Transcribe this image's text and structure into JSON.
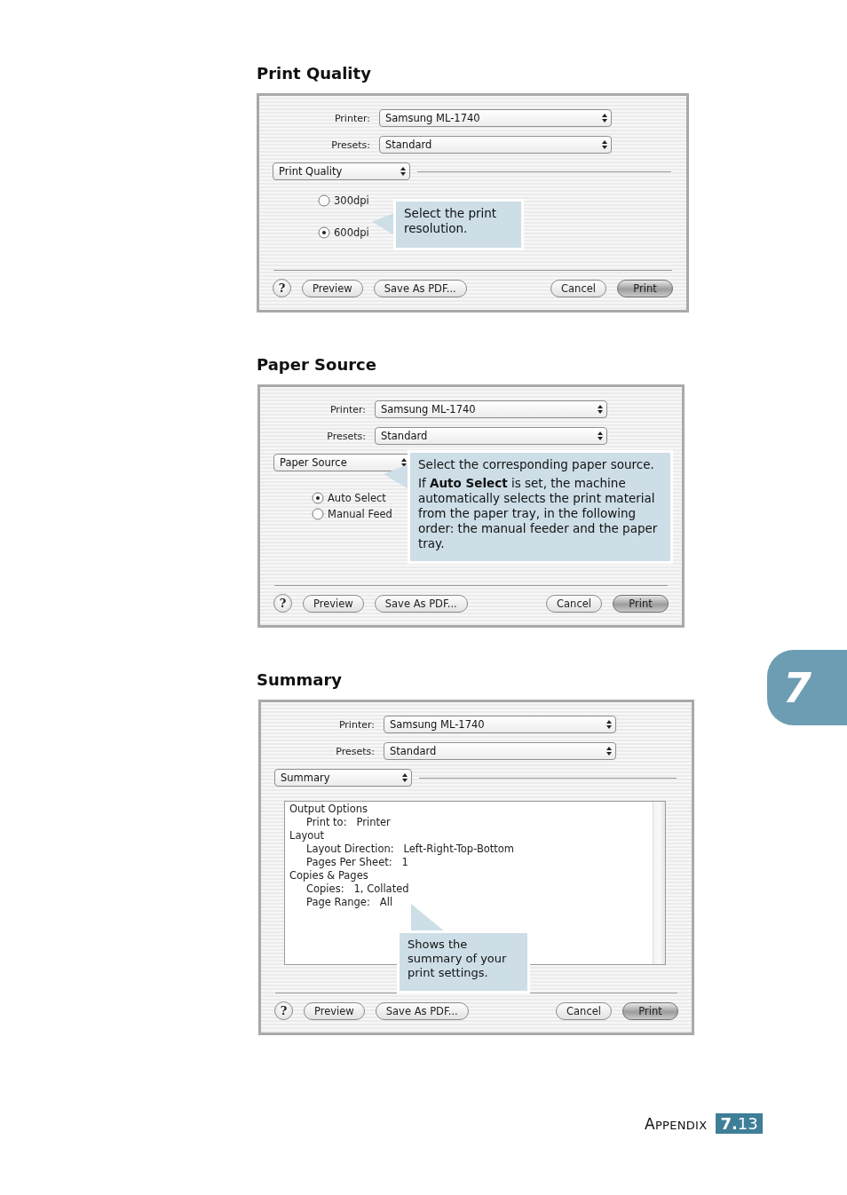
{
  "sections": [
    {
      "heading": "Print Quality",
      "dialog": {
        "fields": [
          {
            "label": "Printer:",
            "value": "Samsung ML-1740"
          },
          {
            "label": "Presets:",
            "value": "Standard"
          }
        ],
        "panel": "Print Quality",
        "content": {
          "kind": "radios",
          "options": [
            {
              "label": "300dpi",
              "selected": false
            },
            {
              "label": "600dpi",
              "selected": true
            }
          ]
        },
        "callout": [
          "Select the print resolution."
        ],
        "buttons": [
          {
            "label": "?",
            "kind": "help"
          },
          {
            "label": "Preview",
            "kind": "push"
          },
          {
            "label": "Save As PDF...",
            "kind": "push"
          },
          {
            "label": "Cancel",
            "kind": "push"
          },
          {
            "label": "Print",
            "kind": "default"
          }
        ]
      }
    },
    {
      "heading": "Paper Source",
      "dialog": {
        "fields": [
          {
            "label": "Printer:",
            "value": "Samsung ML-1740"
          },
          {
            "label": "Presets:",
            "value": "Standard"
          }
        ],
        "panel": "Paper Source",
        "content": {
          "kind": "radios",
          "options": [
            {
              "label": "Auto Select",
              "selected": true
            },
            {
              "label": "Manual Feed",
              "selected": false
            }
          ]
        },
        "callout": [
          "Select the corresponding paper source.",
          "If **Auto Select** is set, the machine automatically selects the print material from the paper tray, in the following order: the manual feeder and the paper tray."
        ],
        "buttons": [
          {
            "label": "?",
            "kind": "help"
          },
          {
            "label": "Preview",
            "kind": "push"
          },
          {
            "label": "Save As PDF...",
            "kind": "push"
          },
          {
            "label": "Cancel",
            "kind": "push"
          },
          {
            "label": "Print",
            "kind": "default"
          }
        ]
      }
    },
    {
      "heading": "Summary",
      "dialog": {
        "fields": [
          {
            "label": "Printer:",
            "value": "Samsung ML-1740"
          },
          {
            "label": "Presets:",
            "value": "Standard"
          }
        ],
        "panel": "Summary",
        "content": {
          "kind": "summary",
          "items": [
            {
              "label": "Output Options",
              "children": [
                {
                  "label": "Print to:",
                  "value": "Printer"
                }
              ]
            },
            {
              "label": "Layout",
              "children": [
                {
                  "label": "Layout Direction:",
                  "value": "Left-Right-Top-Bottom"
                },
                {
                  "label": "Pages Per Sheet:",
                  "value": "1"
                }
              ]
            },
            {
              "label": "Copies & Pages",
              "children": [
                {
                  "label": "Copies:",
                  "value": "1, Collated"
                },
                {
                  "label": "Page Range:",
                  "value": "All"
                }
              ]
            }
          ]
        },
        "callout": [
          "Shows the summary of your print settings."
        ],
        "buttons": [
          {
            "label": "?",
            "kind": "help"
          },
          {
            "label": "Preview",
            "kind": "push"
          },
          {
            "label": "Save As PDF...",
            "kind": "push"
          },
          {
            "label": "Cancel",
            "kind": "push"
          },
          {
            "label": "Print",
            "kind": "default"
          }
        ]
      }
    }
  ],
  "chapter_tab": "7",
  "footer": {
    "label": "APPENDIX",
    "page": "**7.**13"
  }
}
